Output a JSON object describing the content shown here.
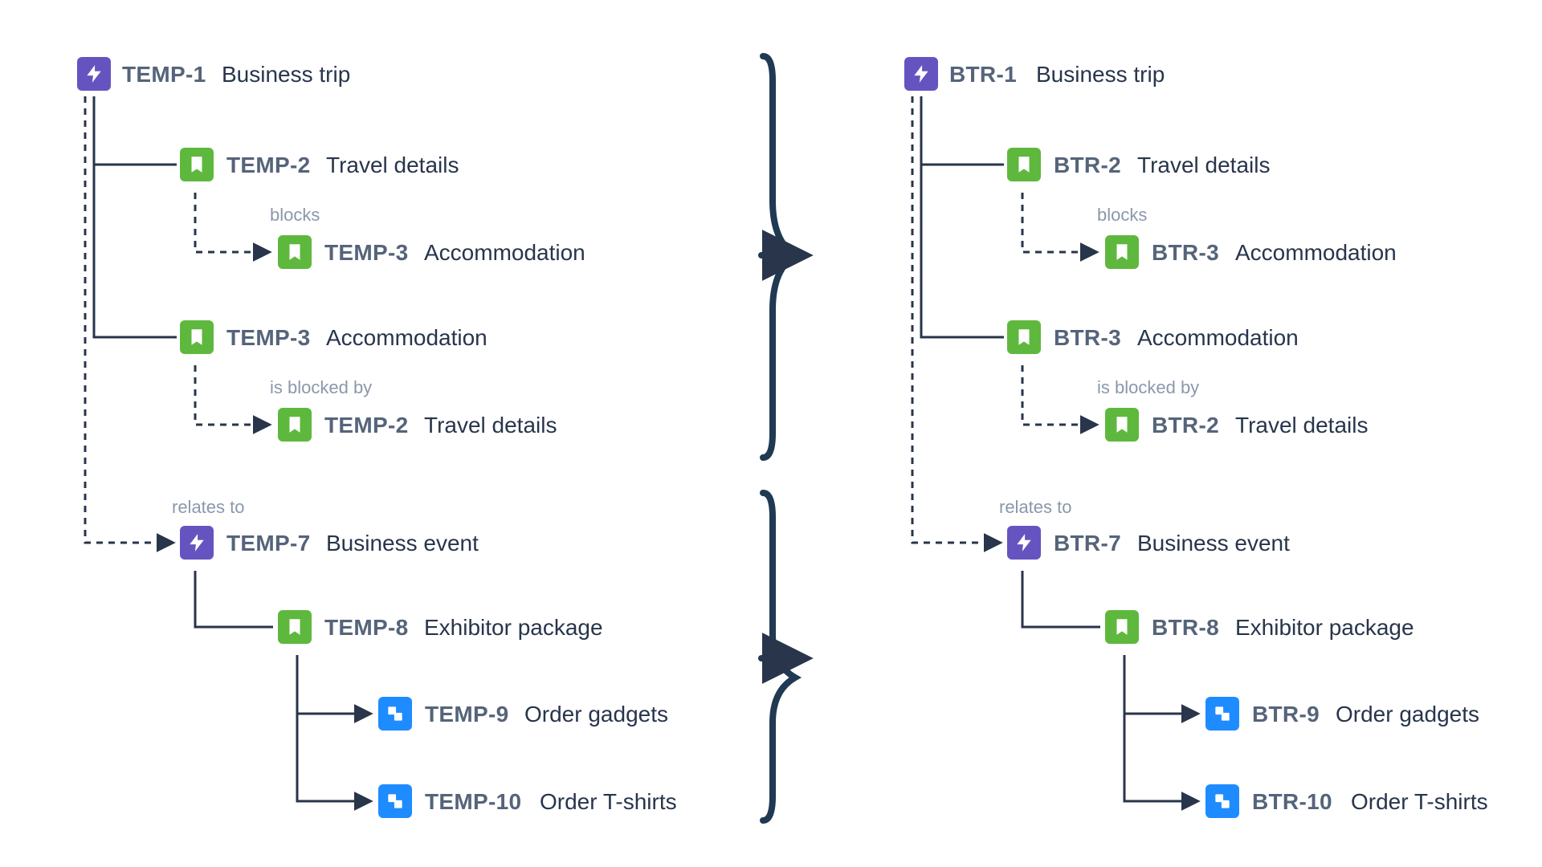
{
  "left": {
    "n1": {
      "key": "TEMP-1",
      "title": "Business trip"
    },
    "n2": {
      "key": "TEMP-2",
      "title": "Travel details"
    },
    "n3": {
      "key": "TEMP-3",
      "title": "Accommodation"
    },
    "n3b": {
      "key": "TEMP-3",
      "title": "Accommodation"
    },
    "n2b": {
      "key": "TEMP-2",
      "title": "Travel details"
    },
    "n7": {
      "key": "TEMP-7",
      "title": "Business event"
    },
    "n8": {
      "key": "TEMP-8",
      "title": "Exhibitor package"
    },
    "n9": {
      "key": "TEMP-9",
      "title": "Order gadgets"
    },
    "n10": {
      "key": "TEMP-10",
      "title": "Order T-shirts"
    },
    "rel_blocks": "blocks",
    "rel_blockedby": "is blocked by",
    "rel_relates": "relates to"
  },
  "right": {
    "n1": {
      "key": "BTR-1",
      "title": "Business trip"
    },
    "n2": {
      "key": "BTR-2",
      "title": "Travel details"
    },
    "n3": {
      "key": "BTR-3",
      "title": "Accommodation"
    },
    "n3b": {
      "key": "BTR-3",
      "title": "Accommodation"
    },
    "n2b": {
      "key": "BTR-2",
      "title": "Travel details"
    },
    "n7": {
      "key": "BTR-7",
      "title": "Business event"
    },
    "n8": {
      "key": "BTR-8",
      "title": "Exhibitor package"
    },
    "n9": {
      "key": "BTR-9",
      "title": "Order gadgets"
    },
    "n10": {
      "key": "BTR-10",
      "title": "Order T-shirts"
    },
    "rel_blocks": "blocks",
    "rel_blockedby": "is blocked by",
    "rel_relates": "relates to"
  }
}
